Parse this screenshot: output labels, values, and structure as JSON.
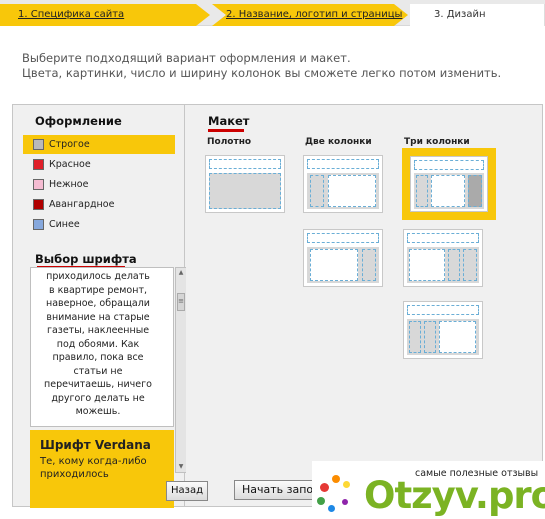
{
  "wizard": {
    "step1": "1. Специфика сайта",
    "step2": "2. Название, логотип и страницы",
    "step3": "3. Дизайн"
  },
  "intro": {
    "line1": "Выберите подходящий вариант оформления и макет.",
    "line2": "Цвета, картинки, число и ширину колонок вы сможете легко потом изменить."
  },
  "styles": {
    "title": "Оформление",
    "items": [
      {
        "label": "Строгое",
        "color": "#b9b9b9",
        "selected": true
      },
      {
        "label": "Красное",
        "color": "#e0202a"
      },
      {
        "label": "Нежное",
        "color": "#f5bcd2"
      },
      {
        "label": "Авангардное",
        "color": "#b00000"
      },
      {
        "label": "Синее",
        "color": "#86a8dd"
      }
    ]
  },
  "fonts": {
    "title": "Выбор шрифта",
    "sample_text": "приходилось делать в квартире ремонт, наверное, обращали внимание на старые газеты, наклеенные под обоями. Как правило, пока все статьи не перечитаешь, ничего другого делать не можешь.",
    "selected_name": "Шрифт Verdana",
    "selected_text": "Те, кому когда-либо приходилось"
  },
  "layout": {
    "title": "Макет",
    "col1": "Полотно",
    "col2": "Две колонки",
    "col3": "Три колонки"
  },
  "buttons": {
    "back": "Назад",
    "start": "Начать запо"
  },
  "watermark": {
    "caption": "самые полезные отзывы",
    "logo": "Otzyv.pro"
  },
  "colors": {
    "accent": "#f8c70a",
    "underline": "#cc0000"
  }
}
